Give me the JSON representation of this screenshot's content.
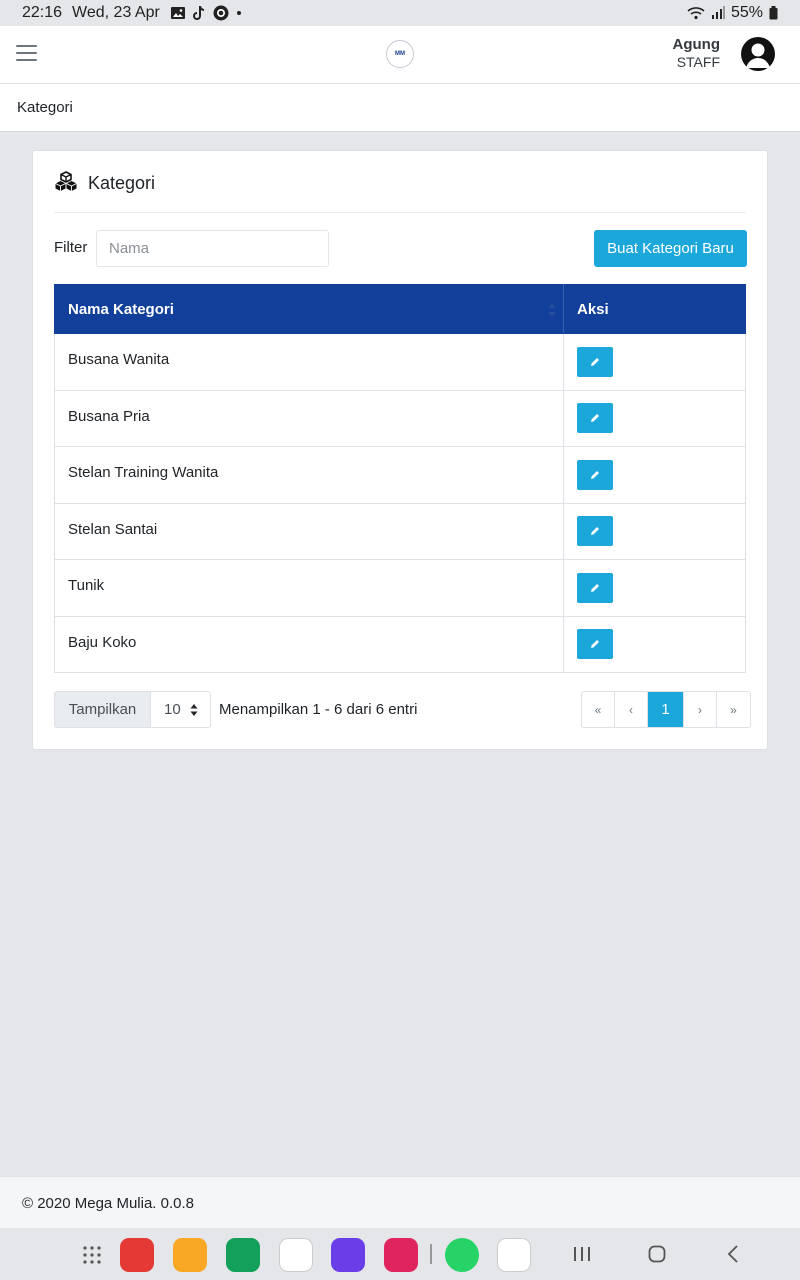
{
  "statusbar": {
    "time": "22:16",
    "date": "Wed, 23 Apr",
    "battery": "55%"
  },
  "header": {
    "logo_text": "MM",
    "user_name": "Agung",
    "user_role": "STAFF"
  },
  "breadcrumb": "Kategori",
  "card": {
    "title": "Kategori",
    "filter_label": "Filter",
    "filter_placeholder": "Nama",
    "create_button": "Buat Kategori Baru",
    "columns": [
      "Nama Kategori",
      "Aksi"
    ],
    "rows": [
      {
        "name": "Busana Wanita"
      },
      {
        "name": "Busana Pria"
      },
      {
        "name": "Stelan Training Wanita"
      },
      {
        "name": "Stelan Santai"
      },
      {
        "name": "Tunik"
      },
      {
        "name": "Baju Koko"
      }
    ],
    "show_label": "Tampilkan",
    "page_size": "10",
    "info": "Menampilkan 1 - 6 dari 6 entri",
    "pager": {
      "first": "«",
      "prev": "‹",
      "current": "1",
      "next": "›",
      "last": "»"
    }
  },
  "footer": "© 2020 Mega Mulia. 0.0.8",
  "colors": {
    "primary": "#113f9a",
    "accent": "#1ca7db"
  }
}
